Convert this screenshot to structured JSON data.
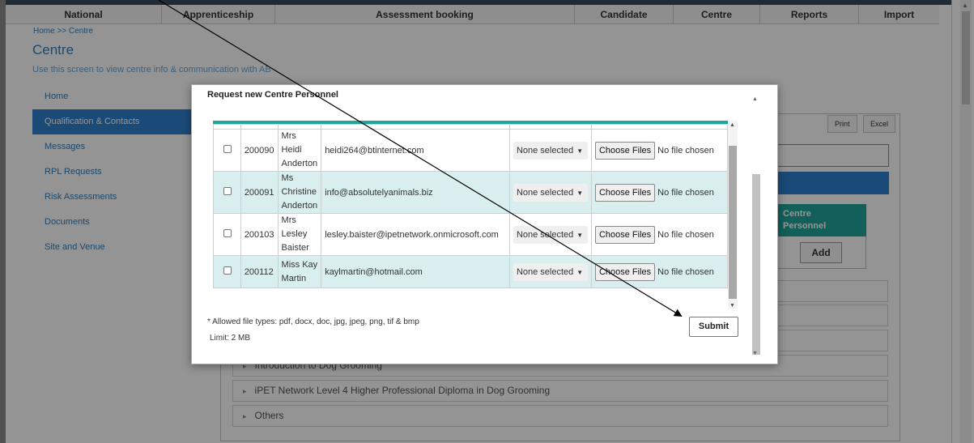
{
  "nav": {
    "items": [
      {
        "label": "National"
      },
      {
        "label": "Apprenticeship"
      },
      {
        "label": "Assessment booking"
      },
      {
        "label": "Candidate"
      },
      {
        "label": "Centre"
      },
      {
        "label": "Reports"
      },
      {
        "label": "Import"
      }
    ]
  },
  "breadcrumb": "Home >> Centre",
  "page": {
    "title": "Centre",
    "description": "Use this screen to view centre info & communication with AB"
  },
  "sidebar": {
    "items": [
      {
        "label": "Home",
        "active": false
      },
      {
        "label": "Qualification & Contacts",
        "active": true
      },
      {
        "label": "Messages",
        "active": false
      },
      {
        "label": "RPL Requests",
        "active": false
      },
      {
        "label": "Risk Assessments",
        "active": false
      },
      {
        "label": "Documents",
        "active": false
      },
      {
        "label": "Site and Venue",
        "active": false
      }
    ]
  },
  "background": {
    "print_label": "Print",
    "excel_label": "Excel",
    "centre_personnel": {
      "title_line1": "Centre",
      "title_line2": "Personnel",
      "add_label": "Add"
    },
    "accordion": [
      {
        "label": "Introduction to Dog Grooming"
      },
      {
        "label": "iPET Network Level 4 Higher Professional Diploma in Dog Grooming"
      },
      {
        "label": "Others"
      }
    ]
  },
  "modal": {
    "title": "Request new Centre Personnel",
    "rows": [
      {
        "id": "200090",
        "title": "Mrs",
        "first": "Heidi",
        "last": "Anderton",
        "email": "heidi264@btinternet.com",
        "select_value": "None selected",
        "file_button": "Choose Files",
        "file_status": "No file chosen"
      },
      {
        "id": "200091",
        "title": "Ms",
        "first": "Christine",
        "last": "Anderton",
        "email": "info@absolutelyanimals.biz",
        "select_value": "None selected",
        "file_button": "Choose Files",
        "file_status": "No file chosen"
      },
      {
        "id": "200103",
        "title": "Mrs",
        "first": "Lesley",
        "last": "Baister",
        "email": "lesley.baister@ipetnetwork.onmicrosoft.com",
        "select_value": "None selected",
        "file_button": "Choose Files",
        "file_status": "No file chosen"
      },
      {
        "id": "200112",
        "title": "Miss Kay",
        "first": "",
        "last": "Martin",
        "email": "kaylmartin@hotmail.com",
        "select_value": "None selected",
        "file_button": "Choose Files",
        "file_status": "No file chosen"
      }
    ],
    "allowed_types_note": "* Allowed file types: pdf, docx, doc, jpg, jpeg, png, tif & bmp",
    "limit_note": "Limit: 2 MB",
    "submit_label": "Submit"
  },
  "colors": {
    "accent_blue": "#2e82cf",
    "teal": "#1fa59a",
    "row_alt": "#d9eeee"
  }
}
